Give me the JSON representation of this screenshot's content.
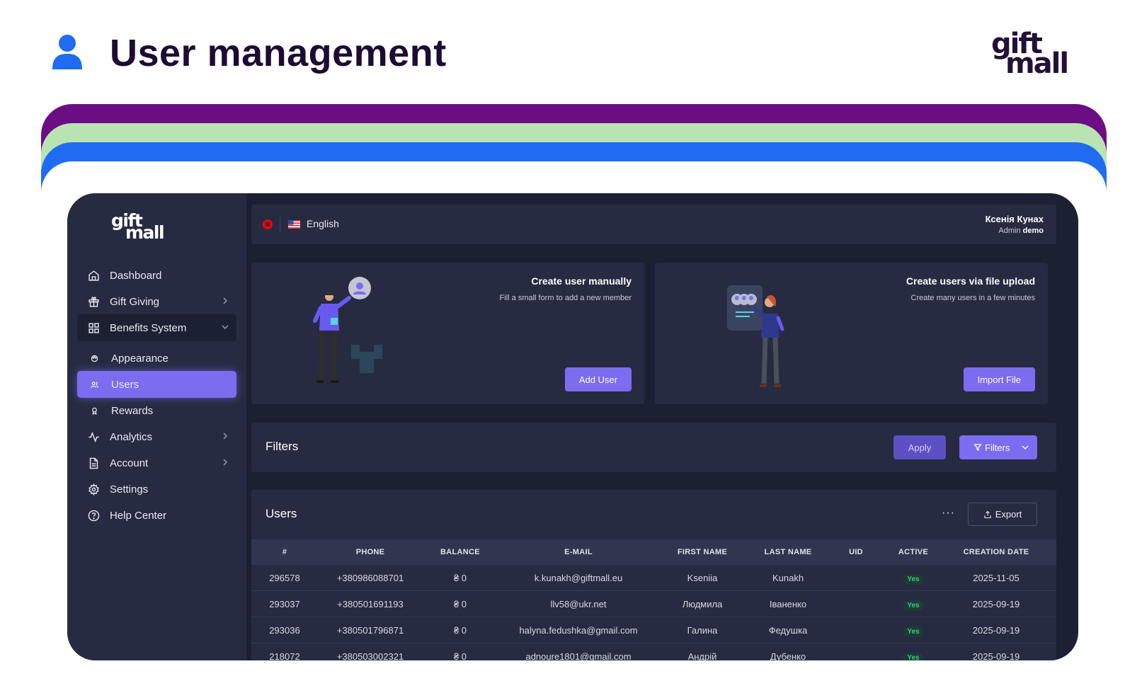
{
  "slide": {
    "title": "User management",
    "brand_line1": "gift",
    "brand_line2": "mall"
  },
  "sidebar": {
    "logo_line1": "gift",
    "logo_line2": "mall",
    "items": [
      {
        "label": "Dashboard",
        "icon": "home-icon"
      },
      {
        "label": "Gift Giving",
        "icon": "gift-icon"
      },
      {
        "label": "Benefits System",
        "icon": "grid-icon"
      },
      {
        "label": "Appearance",
        "icon": "palette-icon"
      },
      {
        "label": "Users",
        "icon": "users-icon"
      },
      {
        "label": "Rewards",
        "icon": "award-icon"
      },
      {
        "label": "Analytics",
        "icon": "activity-icon"
      },
      {
        "label": "Account",
        "icon": "document-icon"
      },
      {
        "label": "Settings",
        "icon": "gear-icon"
      },
      {
        "label": "Help Center",
        "icon": "help-icon"
      }
    ]
  },
  "topbar": {
    "brand_badge": "N",
    "language": "English",
    "user_name": "Ксенія Кунах",
    "user_role": "Admin",
    "user_org": "demo"
  },
  "cards": {
    "create": {
      "title": "Create user manually",
      "subtitle": "Fill a small form to add a new member",
      "button": "Add User"
    },
    "upload": {
      "title": "Create users via file upload",
      "subtitle": "Create many users in a few minutes",
      "button": "Import File"
    }
  },
  "filters": {
    "title": "Filters",
    "apply_label": "Apply",
    "filters_label": "Filters"
  },
  "users_table": {
    "title": "Users",
    "more_label": "···",
    "export_label": "Export",
    "columns": [
      "#",
      "PHONE",
      "BALANCE",
      "E-MAIL",
      "FIRST NAME",
      "LAST NAME",
      "UID",
      "ACTIVE",
      "CREATION DATE"
    ],
    "rows": [
      [
        "296578",
        "+380986088701",
        "₴ 0",
        "k.kunakh@giftmall.eu",
        "Kseniia",
        "Kunakh",
        "",
        "Yes",
        "2025-11-05"
      ],
      [
        "293037",
        "+380501691193",
        "₴ 0",
        "llv58@ukr.net",
        "Людмила",
        "Іваненко",
        "",
        "Yes",
        "2025-09-19"
      ],
      [
        "293036",
        "+380501796871",
        "₴ 0",
        "halyna.fedushka@gmail.com",
        "Галина",
        "Федушка",
        "",
        "Yes",
        "2025-09-19"
      ],
      [
        "218072",
        "+380503002321",
        "₴ 0",
        "adnoure1801@gmail.com",
        "Андрій",
        "Дубенко",
        "",
        "Yes",
        "2025-09-19"
      ]
    ]
  },
  "colors": {
    "accent": "#7b6cf0",
    "band_purple": "#6b0e84",
    "band_green": "#b9e4b1",
    "band_blue": "#1f6cf2",
    "app_bg": "#1c2033",
    "panel_bg": "#262b41",
    "active_badge": "#33d17a"
  }
}
